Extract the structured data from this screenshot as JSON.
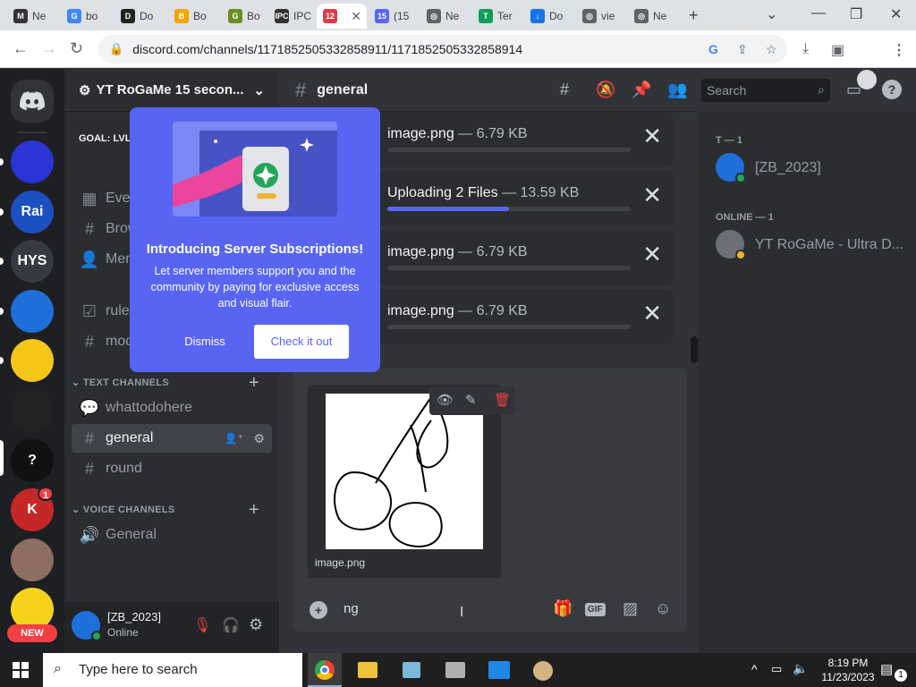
{
  "browser": {
    "tabs": [
      {
        "label": "Ne",
        "fav": "M",
        "color": "#333333"
      },
      {
        "label": "bo",
        "fav": "G",
        "color": "#4285f4"
      },
      {
        "label": "Do",
        "fav": "D",
        "color": "#222222"
      },
      {
        "label": "Bo",
        "fav": "B",
        "color": "#f0a500"
      },
      {
        "label": "Bo",
        "fav": "G",
        "color": "#6b8e23"
      },
      {
        "label": "IPC",
        "fav": "IPC",
        "color": "#333333"
      },
      {
        "label": "",
        "fav": "12",
        "color": "#e03c4a"
      },
      {
        "label": "(15",
        "fav": "15",
        "color": "#5865f2"
      },
      {
        "label": "Ne",
        "fav": "◎",
        "color": "#5f6368"
      },
      {
        "label": "Ter",
        "fav": "T",
        "color": "#0f9d58"
      },
      {
        "label": "Do",
        "fav": "↓",
        "color": "#1a73e8"
      },
      {
        "label": "vie",
        "fav": "◎",
        "color": "#5f6368"
      },
      {
        "label": "Ne",
        "fav": "◎",
        "color": "#5f6368"
      }
    ],
    "url": "discord.com/channels/1171852505332858911/1171852505332858914"
  },
  "server": {
    "name": "YT RoGaMe 15 secon...",
    "goal": "GOAL: LVL",
    "channels_top": [
      {
        "icon": "events-icon",
        "glyph": "▦",
        "label": "Even"
      },
      {
        "icon": "browse-icon",
        "glyph": "#",
        "label": "Brow"
      },
      {
        "icon": "members-icon",
        "glyph": "👤",
        "label": "Mem"
      },
      {
        "icon": "rules-icon",
        "glyph": "☑",
        "label": "rules"
      },
      {
        "icon": "hash-icon",
        "glyph": "#",
        "label": "mod"
      }
    ],
    "text_category": "TEXT CHANNELS",
    "text_channels": [
      {
        "icon": "forum-icon",
        "glyph": "💬",
        "label": "whattodohere"
      },
      {
        "icon": "hash-icon",
        "glyph": "#",
        "label": "general"
      },
      {
        "icon": "hash-icon",
        "glyph": "#",
        "label": "round"
      }
    ],
    "voice_category": "VOICE CHANNELS",
    "voice_channels": [
      {
        "icon": "speaker-icon",
        "glyph": "🔊",
        "label": "General"
      }
    ],
    "sidebar_servers": [
      {
        "label": "",
        "bg": "#2b35d6"
      },
      {
        "label": "Rai",
        "bg": "#1c4fbf"
      },
      {
        "label": "HYS",
        "bg": "#36393f"
      },
      {
        "label": "",
        "bg": "#1e6fd9"
      },
      {
        "label": "",
        "bg": "#f5c518"
      },
      {
        "label": "",
        "bg": "#222222"
      },
      {
        "label": "?",
        "bg": "#111111"
      },
      {
        "label": "K",
        "bg": "#c62828"
      },
      {
        "label": "",
        "bg": "#8d6e63"
      },
      {
        "label": "",
        "bg": "#f6d21b"
      }
    ],
    "badge_count": "1",
    "new_label": "NEW"
  },
  "popup": {
    "title": "Introducing Server Subscriptions!",
    "body": "Let server members support you and the community by paying for exclusive access and visual flair.",
    "dismiss": "Dismiss",
    "check": "Check it out"
  },
  "chat": {
    "channel": "general",
    "search_placeholder": "Search",
    "uploads": [
      {
        "name": "image.png",
        "size": "— 6.79 KB",
        "progress": 0
      },
      {
        "name": "Uploading 2 Files",
        "size": "— 13.59 KB",
        "progress": 0.5
      },
      {
        "name": "image.png",
        "size": "— 6.79 KB",
        "progress": 0
      },
      {
        "name": "image.png",
        "size": "— 6.79 KB",
        "progress": 0
      }
    ],
    "attachment_name": "image.png",
    "input_value": "ng"
  },
  "user": {
    "name": "[ZB_2023]",
    "status": "Online"
  },
  "members": {
    "group1": "T — 1",
    "member1": "[ZB_2023]",
    "group2": "ONLINE — 1",
    "member2": "YT RoGaMe - Ultra D..."
  },
  "taskbar": {
    "search_placeholder": "Type here to search",
    "time": "8:19 PM",
    "date": "11/23/2023",
    "notif_count": "1"
  }
}
